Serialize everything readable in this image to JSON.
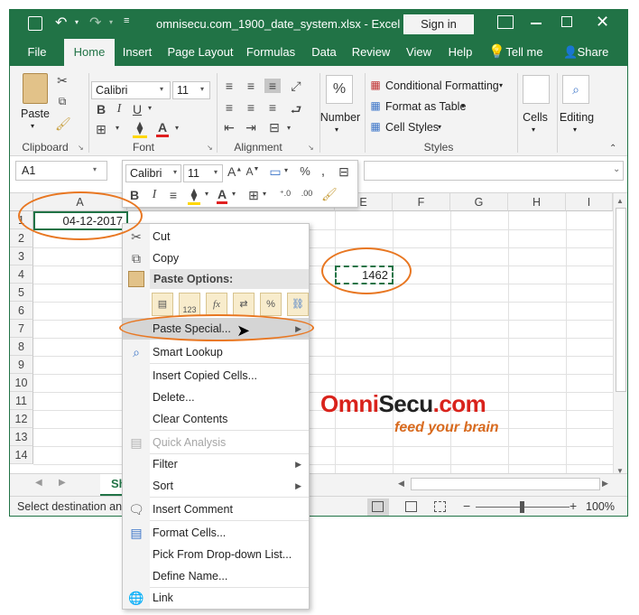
{
  "window": {
    "title": "omnisecu.com_1900_date_system.xlsx  -  Excel",
    "sign_in": "Sign in"
  },
  "tabs": [
    {
      "label": "File"
    },
    {
      "label": "Home"
    },
    {
      "label": "Insert"
    },
    {
      "label": "Page Layout"
    },
    {
      "label": "Formulas"
    },
    {
      "label": "Data"
    },
    {
      "label": "Review"
    },
    {
      "label": "View"
    },
    {
      "label": "Help"
    },
    {
      "label": "Tell me"
    },
    {
      "label": "Share"
    }
  ],
  "ribbon": {
    "clipboard": {
      "paste": "Paste",
      "label": "Clipboard"
    },
    "font": {
      "name": "Calibri",
      "size": "11",
      "label": "Font"
    },
    "alignment": {
      "label": "Alignment"
    },
    "number": {
      "label": "Number"
    },
    "styles": {
      "conditional": "Conditional Formatting",
      "table": "Format as Table",
      "cell_styles": "Cell Styles",
      "label": "Styles"
    },
    "cells": {
      "label": "Cells"
    },
    "editing": {
      "label": "Editing"
    }
  },
  "formula_bar": {
    "name_box": "A1"
  },
  "mini_toolbar": {
    "font": "Calibri",
    "size": "11"
  },
  "grid": {
    "columns": [
      "A",
      "E",
      "F",
      "G",
      "H",
      "I"
    ],
    "rows": [
      "1",
      "2",
      "3",
      "4",
      "5",
      "6",
      "7",
      "8",
      "9",
      "10",
      "11",
      "12",
      "13",
      "14"
    ],
    "cell_a1": "04-12-2017",
    "cell_e4": "1462"
  },
  "context_menu": {
    "cut": "Cut",
    "copy": "Copy",
    "paste_options": "Paste Options:",
    "paste_special": "Paste Special...",
    "smart_lookup": "Smart Lookup",
    "insert_copied": "Insert Copied Cells...",
    "delete": "Delete...",
    "clear_contents": "Clear Contents",
    "quick_analysis": "Quick Analysis",
    "filter": "Filter",
    "sort": "Sort",
    "insert_comment": "Insert Comment",
    "format_cells": "Format Cells...",
    "pick_dropdown": "Pick From Drop-down List...",
    "define_name": "Define Name...",
    "link": "Link",
    "paste_icon_text": "123"
  },
  "logo": {
    "omni": "Omni",
    "secu": "Secu",
    "com": ".com",
    "tagline": "feed your brain"
  },
  "sheet": {
    "tab": "Sh"
  },
  "status": {
    "text": "Select destination and",
    "zoom": "100%"
  },
  "colors": {
    "excel_green": "#217346",
    "highlight": "#e87722",
    "logo_red": "#d9231c"
  }
}
